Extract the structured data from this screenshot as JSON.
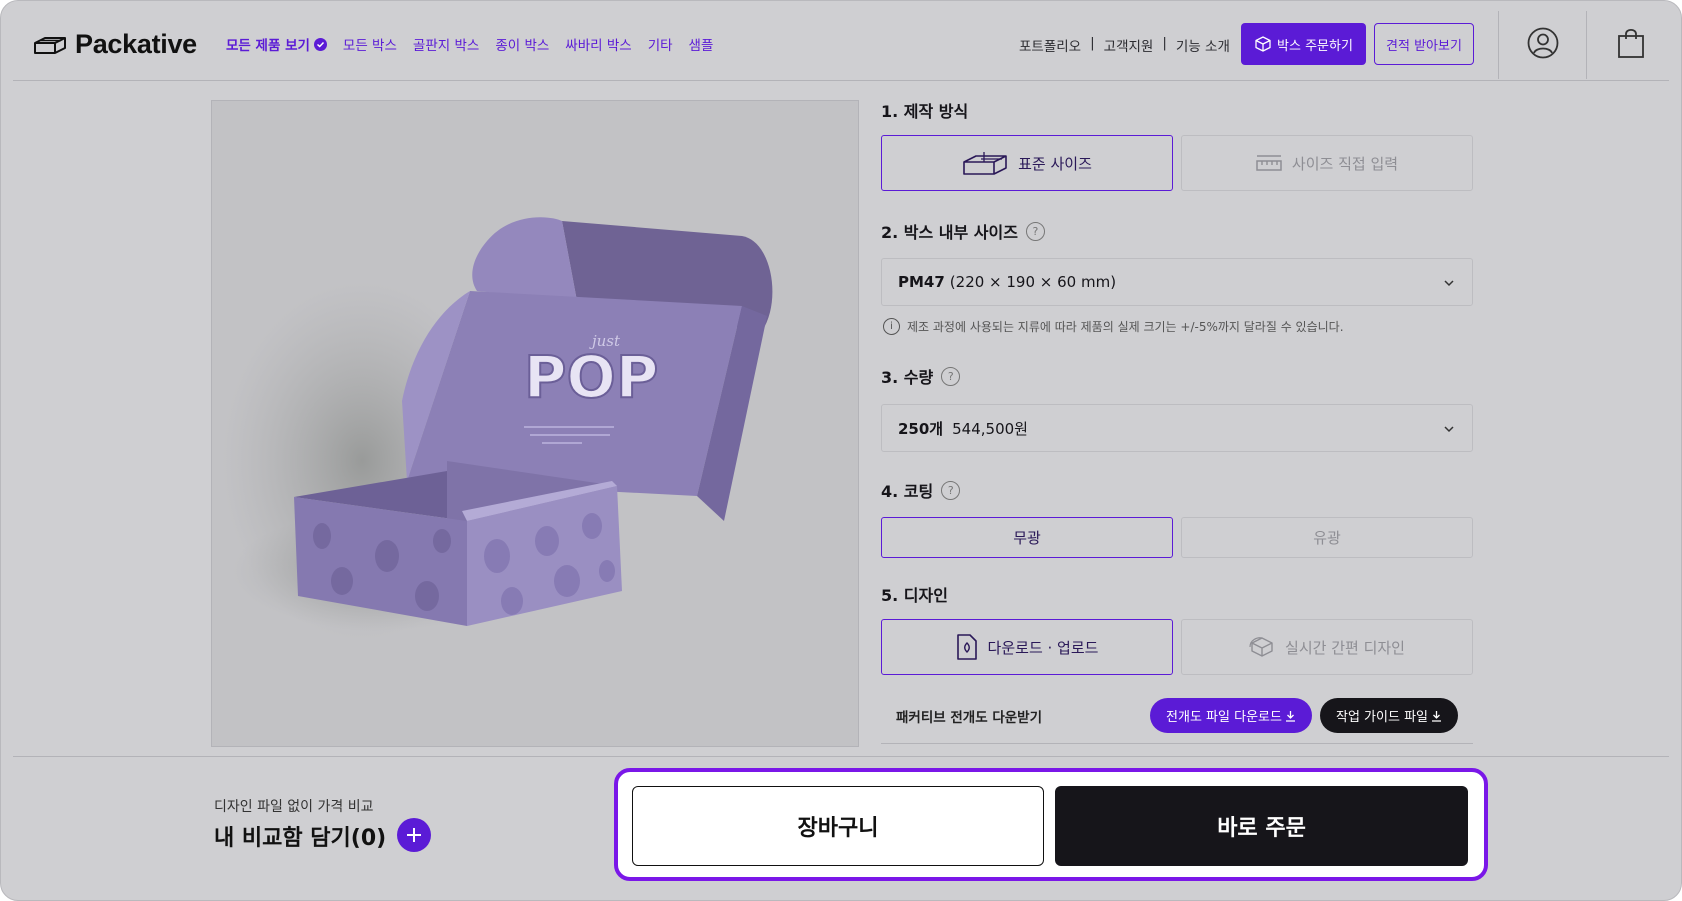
{
  "brand": {
    "name": "Packative",
    "logo_icon": "box-outline-icon"
  },
  "nav": {
    "items": [
      "모든 제품 보기",
      "모든 박스",
      "골판지 박스",
      "종이 박스",
      "싸바리 박스",
      "기타",
      "샘플"
    ]
  },
  "header_links": [
    "포트폴리오",
    "고객지원",
    "기능 소개"
  ],
  "header_separator": "|",
  "header_buttons": {
    "order": "박스 주문하기",
    "quote": "견적 받아보기"
  },
  "product_image": {
    "lid_text_small": "just",
    "lid_text_big": "POP"
  },
  "options": {
    "method": {
      "title": "1. 제작 방식",
      "choices": [
        {
          "label": "표준 사이즈",
          "icon": "box-icon",
          "selected": true
        },
        {
          "label": "사이즈 직접 입력",
          "icon": "ruler-icon",
          "selected": false
        }
      ]
    },
    "size": {
      "title": "2. 박스 내부 사이즈",
      "help": "?",
      "value_code": "PM47",
      "value_dims": "(220 × 190 × 60 mm)",
      "note_icon": "i",
      "note": "제조 과정에 사용되는 지류에 따라 제품의 실제 크기는 +/-5%까지 달라질 수 있습니다."
    },
    "quantity": {
      "title": "3. 수량",
      "help": "?",
      "value_qty": "250개",
      "value_price": "544,500원"
    },
    "coating": {
      "title": "4. 코팅",
      "help": "?",
      "choices": [
        {
          "label": "무광",
          "selected": true
        },
        {
          "label": "유광",
          "selected": false
        }
      ]
    },
    "design": {
      "title": "5. 디자인",
      "choices": [
        {
          "label": "다운로드 · 업로드",
          "icon": "file-upload-icon",
          "selected": true
        },
        {
          "label": "실시간 간편 디자인",
          "icon": "box-3d-icon",
          "selected": false
        }
      ],
      "download_label": "패커티브 전개도 다운받기",
      "download_dieline": "전개도 파일 다운로드",
      "download_guide": "작업 가이드 파일"
    }
  },
  "compare": {
    "subtitle": "디자인 파일 없이 가격 비교",
    "title": "내 비교함 담기(0)"
  },
  "cta": {
    "cart": "장바구니",
    "buy": "바로 주문"
  },
  "colors": {
    "accent": "#5b1bd6",
    "highlight": "#7a17e8",
    "dark": "#16151a",
    "overlay": "#cfcfd2"
  }
}
